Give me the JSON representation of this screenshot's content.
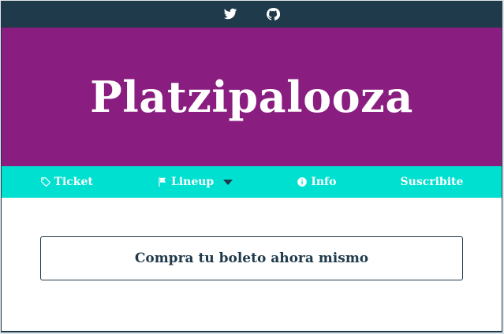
{
  "topbar": {
    "social": [
      {
        "icon": "twitter-icon"
      },
      {
        "icon": "github-icon"
      }
    ]
  },
  "hero": {
    "title": "Platzipalooza"
  },
  "nav": {
    "items": [
      {
        "icon": "tag-icon",
        "label": "Ticket"
      },
      {
        "icon": "flag-icon",
        "label": "Lineup",
        "dropdown": true
      },
      {
        "icon": "info-icon",
        "label": "Info"
      },
      {
        "label": "Suscribite"
      }
    ]
  },
  "main": {
    "cta_label": "Compra tu boleto ahora mismo"
  },
  "colors": {
    "topbar": "#1f3a4a",
    "hero": "#8a1d80",
    "nav": "#00e0d0",
    "text_dark": "#1f3a4a"
  }
}
